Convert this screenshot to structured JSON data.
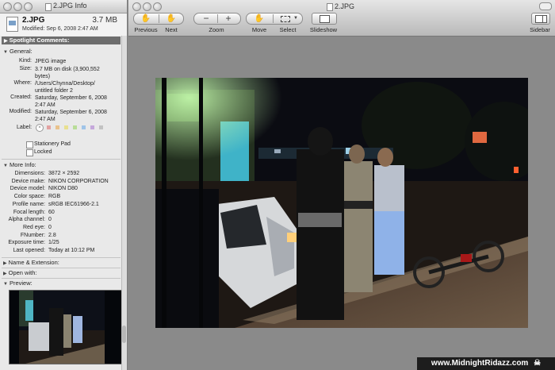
{
  "info_window": {
    "title": "2.JPG Info",
    "file_name": "2.JPG",
    "file_size": "3.7 MB",
    "modified_header": "Modified: Sep 6, 2008 2:47 AM",
    "spotlight_label": "Spotlight Comments:",
    "general_label": "General:",
    "general": [
      {
        "key": "Kind:",
        "value": "JPEG image"
      },
      {
        "key": "Size:",
        "value": "3.7 MB on disk (3,900,552 bytes)"
      },
      {
        "key": "Where:",
        "value": "/Users/Chynna/Desktop/ untitled folder 2"
      },
      {
        "key": "Created:",
        "value": "Saturday, September 6, 2008 2:47 AM"
      },
      {
        "key": "Modified:",
        "value": "Saturday, September 6, 2008 2:47 AM"
      }
    ],
    "label_key": "Label:",
    "label_colors": [
      "#e2a2a2",
      "#e9c28c",
      "#e8e090",
      "#b9dd98",
      "#9fc4e8",
      "#c5a8db",
      "#c2c2c2"
    ],
    "stationery_pad": "Stationery Pad",
    "locked": "Locked",
    "more_info_label": "More Info:",
    "more_info": [
      {
        "key": "Dimensions:",
        "value": "3872 × 2592"
      },
      {
        "key": "Device make:",
        "value": "NIKON CORPORATION"
      },
      {
        "key": "Device model:",
        "value": "NIKON D80"
      },
      {
        "key": "Color space:",
        "value": "RGB"
      },
      {
        "key": "Profile name:",
        "value": "sRGB IEC61966-2.1"
      },
      {
        "key": "Focal length:",
        "value": "60"
      },
      {
        "key": "Alpha channel:",
        "value": "0"
      },
      {
        "key": "Red eye:",
        "value": "0"
      },
      {
        "key": "FNumber:",
        "value": "2.8"
      },
      {
        "key": "Exposure time:",
        "value": "1/25"
      },
      {
        "key": "Last opened:",
        "value": "Today at 10:12 PM"
      }
    ],
    "name_extension_label": "Name & Extension:",
    "open_with_label": "Open with:",
    "preview_label": "Preview:"
  },
  "viewer_window": {
    "title": "2.JPG",
    "toolbar": {
      "previous": "Previous",
      "next": "Next",
      "zoom": "Zoom",
      "move": "Move",
      "select": "Select",
      "slideshow": "Slideshow",
      "sidebar": "Sidebar"
    }
  },
  "watermark": "www.MidnightRidazz.com"
}
